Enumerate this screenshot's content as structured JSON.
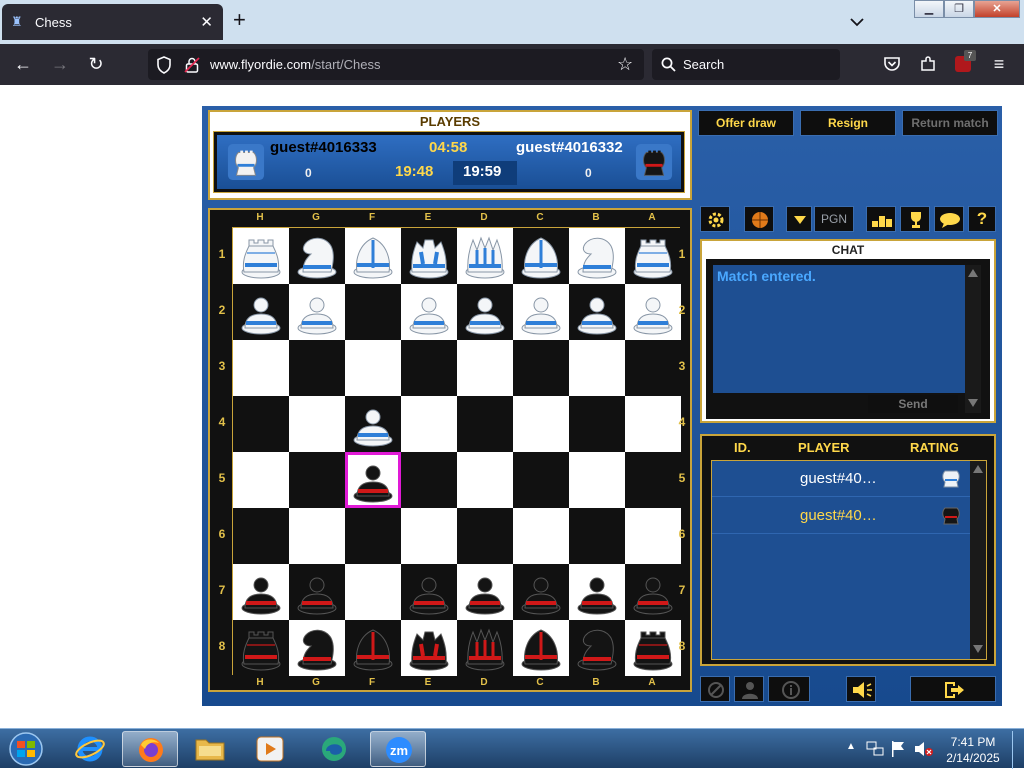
{
  "browser": {
    "tab_title": "Chess",
    "url_host": "www.flyordie.com",
    "url_path": "/start/Chess",
    "search_placeholder": "Search",
    "extension_badge": "7"
  },
  "players_panel": {
    "caption": "PLAYERS",
    "left_player": {
      "name": "guest#4016333",
      "score": "0",
      "move_clock": "04:58",
      "total_clock": "19:48",
      "color": "white"
    },
    "right_player": {
      "name": "guest#4016332",
      "score": "0",
      "total_clock": "19:59",
      "color": "black"
    }
  },
  "controls": {
    "offer_draw": "Offer draw",
    "resign": "Resign",
    "return_match": "Return match",
    "pgn": "PGN"
  },
  "board": {
    "files": [
      "H",
      "G",
      "F",
      "E",
      "D",
      "C",
      "B",
      "A"
    ],
    "ranks": [
      "1",
      "2",
      "3",
      "4",
      "5",
      "6",
      "7",
      "8"
    ],
    "highlighted_square": "F5",
    "rows": [
      [
        "wR",
        "wN",
        "wB",
        "wK",
        "wQ",
        "wB",
        "wN",
        "wR"
      ],
      [
        "wP",
        "wP",
        "",
        "wP",
        "wP",
        "wP",
        "wP",
        "wP"
      ],
      [
        "",
        "",
        "",
        "",
        "",
        "",
        "",
        ""
      ],
      [
        "",
        "",
        "wP",
        "",
        "",
        "",
        "",
        ""
      ],
      [
        "",
        "",
        "bP",
        "",
        "",
        "",
        "",
        ""
      ],
      [
        "",
        "",
        "",
        "",
        "",
        "",
        "",
        ""
      ],
      [
        "bP",
        "bP",
        "",
        "bP",
        "bP",
        "bP",
        "bP",
        "bP"
      ],
      [
        "bR",
        "bN",
        "bB",
        "bK",
        "bQ",
        "bB",
        "bN",
        "bR"
      ]
    ]
  },
  "chat": {
    "caption": "CHAT",
    "messages": [
      "Match entered."
    ],
    "send_label": "Send"
  },
  "player_list": {
    "headers": {
      "id": "ID.",
      "player": "PLAYER",
      "rating": "RATING"
    },
    "rows": [
      {
        "name": "guest#40…",
        "name_color": "#ffffff",
        "side": "white"
      },
      {
        "name": "guest#40…",
        "name_color": "#ffd84a",
        "side": "black"
      }
    ]
  },
  "taskbar": {
    "time": "7:41 PM",
    "date": "2/14/2025",
    "apps": [
      "internet-explorer",
      "firefox",
      "file-explorer",
      "media-player",
      "edge-insider",
      "zoom"
    ]
  },
  "colors": {
    "gold": "#ffd84a",
    "panel_blue": "#1e4f92",
    "highlight": "#e01ad6",
    "white_piece_accent": "#2f7fd8",
    "black_piece_accent": "#d01818"
  }
}
